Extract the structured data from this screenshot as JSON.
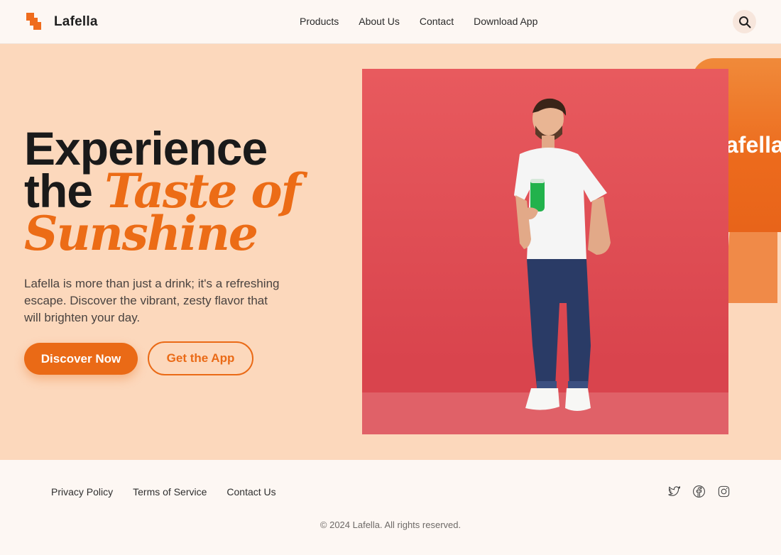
{
  "brand": {
    "name": "Lafella",
    "logo_icon": "stacked-squares-logo",
    "accent": "#ea6a16"
  },
  "nav": {
    "items": [
      "Products",
      "About Us",
      "Contact",
      "Download App"
    ]
  },
  "search": {
    "icon": "search-icon"
  },
  "hero": {
    "headline_line1": "Experience",
    "headline_line2_plain": "the",
    "headline_line2_accent": "Taste of",
    "headline_line3_accent": "Sunshine",
    "description": "Lafella is more than just a drink; it's a refreshing escape. Discover the vibrant, zesty flavor that will brighten your day.",
    "primary_button": "Discover Now",
    "secondary_button": "Get the App",
    "banner_text": "afella"
  },
  "footer": {
    "links": [
      "Privacy Policy",
      "Terms of Service",
      "Contact Us"
    ],
    "socials": [
      "twitter-icon",
      "facebook-icon",
      "instagram-icon"
    ],
    "copyright": "© 2024 Lafella. All rights reserved."
  }
}
